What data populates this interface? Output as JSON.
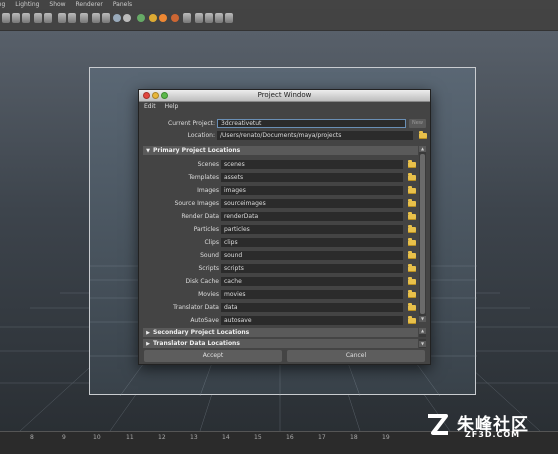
{
  "maya": {
    "menu": [
      "ing",
      "Lighting",
      "Show",
      "Renderer",
      "Panels"
    ],
    "timeline_ticks": [
      "8",
      "9",
      "10",
      "11",
      "12",
      "13",
      "14",
      "15",
      "16",
      "17",
      "18",
      "19"
    ]
  },
  "watermark": {
    "chinese": "朱峰社区",
    "english": "ZF3D.COM"
  },
  "window": {
    "title": "Project Window",
    "menu": [
      "Edit",
      "Help"
    ],
    "current_project_label": "Current Project:",
    "current_project_value": "3dcreativetut",
    "new_button": "New",
    "location_label": "Location:",
    "location_value": "/Users/renato/Documents/maya/projects",
    "primary_section": "Primary Project Locations",
    "locations": [
      {
        "label": "Scenes",
        "value": "scenes"
      },
      {
        "label": "Templates",
        "value": "assets"
      },
      {
        "label": "Images",
        "value": "images"
      },
      {
        "label": "Source Images",
        "value": "sourceimages"
      },
      {
        "label": "Render Data",
        "value": "renderData"
      },
      {
        "label": "Particles",
        "value": "particles"
      },
      {
        "label": "Clips",
        "value": "clips"
      },
      {
        "label": "Sound",
        "value": "sound"
      },
      {
        "label": "Scripts",
        "value": "scripts"
      },
      {
        "label": "Disk Cache",
        "value": "cache"
      },
      {
        "label": "Movies",
        "value": "movies"
      },
      {
        "label": "Translator Data",
        "value": "data"
      },
      {
        "label": "AutoSave",
        "value": "autosave"
      }
    ],
    "secondary_section": "Secondary Project Locations",
    "translator_section": "Translator Data Locations",
    "accept_button": "Accept",
    "cancel_button": "Cancel"
  },
  "colors": {
    "folder": "#e8c04a",
    "close": "#e2473f",
    "minimize": "#e8b73a",
    "zoom": "#5cb84a",
    "active_field_border": "#6a8fb5"
  }
}
